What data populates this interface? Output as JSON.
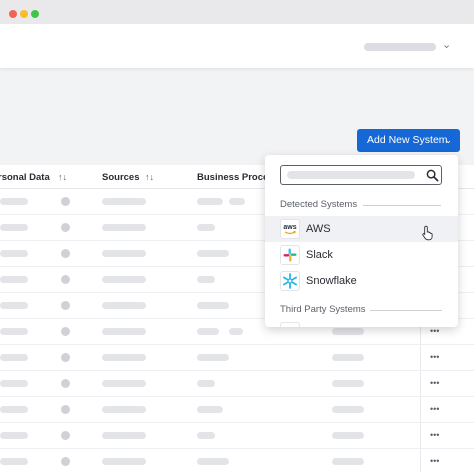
{
  "table": {
    "columns": [
      {
        "label": "rsonal Data",
        "sort": "↑↓"
      },
      {
        "label": "Sources",
        "sort": "↑↓"
      },
      {
        "label": "Business Process",
        "sort": ""
      }
    ],
    "row_action_label": "•••"
  },
  "toolbar": {
    "add_button_label": "Add New System",
    "add_button_chevron": "⌄"
  },
  "header": {
    "user_chevron": "⌄"
  },
  "dropdown": {
    "search_icon": "magnifier-icon",
    "detected_label": "Detected Systems",
    "detected_items": [
      {
        "label": "AWS",
        "icon": "aws-logo-icon"
      },
      {
        "label": "Slack",
        "icon": "slack-logo-icon"
      },
      {
        "label": "Snowflake",
        "icon": "snowflake-logo-icon"
      }
    ],
    "third_party_label": "Third Party Systems"
  },
  "logos": {
    "aws_text": "aws"
  },
  "colors": {
    "accent": "#1668d6",
    "window_bg": "#f2f3f5",
    "skeleton": "#e3e4e8",
    "aws_orange": "#ff9900",
    "snowflake_blue": "#29b5e8"
  }
}
